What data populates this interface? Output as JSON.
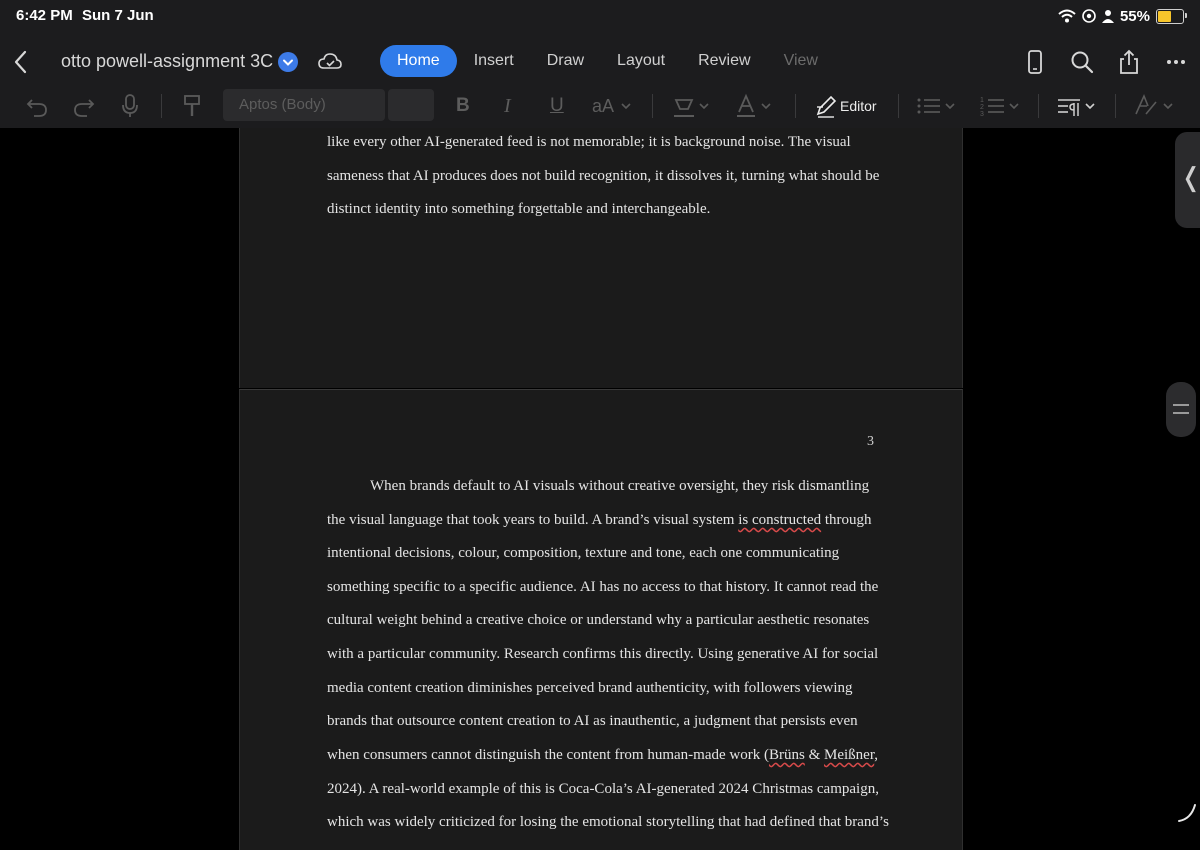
{
  "status_bar": {
    "time": "6:42 PM",
    "date": "Sun 7 Jun",
    "battery_text": "55%",
    "battery_level": 0.55,
    "icons": [
      "wifi-icon",
      "focus-icon",
      "person-icon",
      "battery-icon"
    ]
  },
  "title_bar": {
    "document_title": "otto powell-assignment 3C",
    "tabs": [
      {
        "label": "Home",
        "active": true
      },
      {
        "label": "Insert",
        "active": false
      },
      {
        "label": "Draw",
        "active": false
      },
      {
        "label": "Layout",
        "active": false
      },
      {
        "label": "Review",
        "active": false
      },
      {
        "label": "View",
        "active": false
      }
    ],
    "right_icons": [
      "phone-layout-icon",
      "search-icon",
      "share-icon",
      "more-icon"
    ]
  },
  "toolbar": {
    "font_name": "Aptos (Body)",
    "font_size": "",
    "bold": "B",
    "italic": "I",
    "underline": "U",
    "text_size": "aA",
    "editor_label": "Editor"
  },
  "document": {
    "page2_lines": [
      "like every other AI-generated feed is not memorable; it is background noise. The visual",
      "sameness that AI produces does not build recognition, it dissolves it, turning what should be",
      "distinct identity into something forgettable and interchangeable."
    ],
    "page3_number": "3",
    "page3_lines": [
      "When brands default to AI visuals without creative oversight, they risk dismantling",
      "the visual language that took years to build. A brand’s visual system ",
      "is constructed",
      " through",
      "intentional decisions, colour, composition, texture and tone, each one communicating",
      "something specific to a specific audience. AI has no access to that history. It cannot read the",
      "cultural weight behind a creative choice or understand why a particular aesthetic resonates",
      "with a particular community. Research confirms this directly. Using generative AI for social",
      "media content creation diminishes perceived brand authenticity, with followers viewing",
      "brands that outsource content creation to AI as inauthentic, a judgment that persists even",
      "when consumers cannot distinguish the content from human-made work (",
      "Brüns",
      " & ",
      "Meißner",
      ", ",
      "2024). A real-world example of this is Coca-Cola’s AI-generated 2024 Christmas campaign,",
      "which was widely criticized for losing the emotional storytelling that had defined that brand’s"
    ]
  }
}
